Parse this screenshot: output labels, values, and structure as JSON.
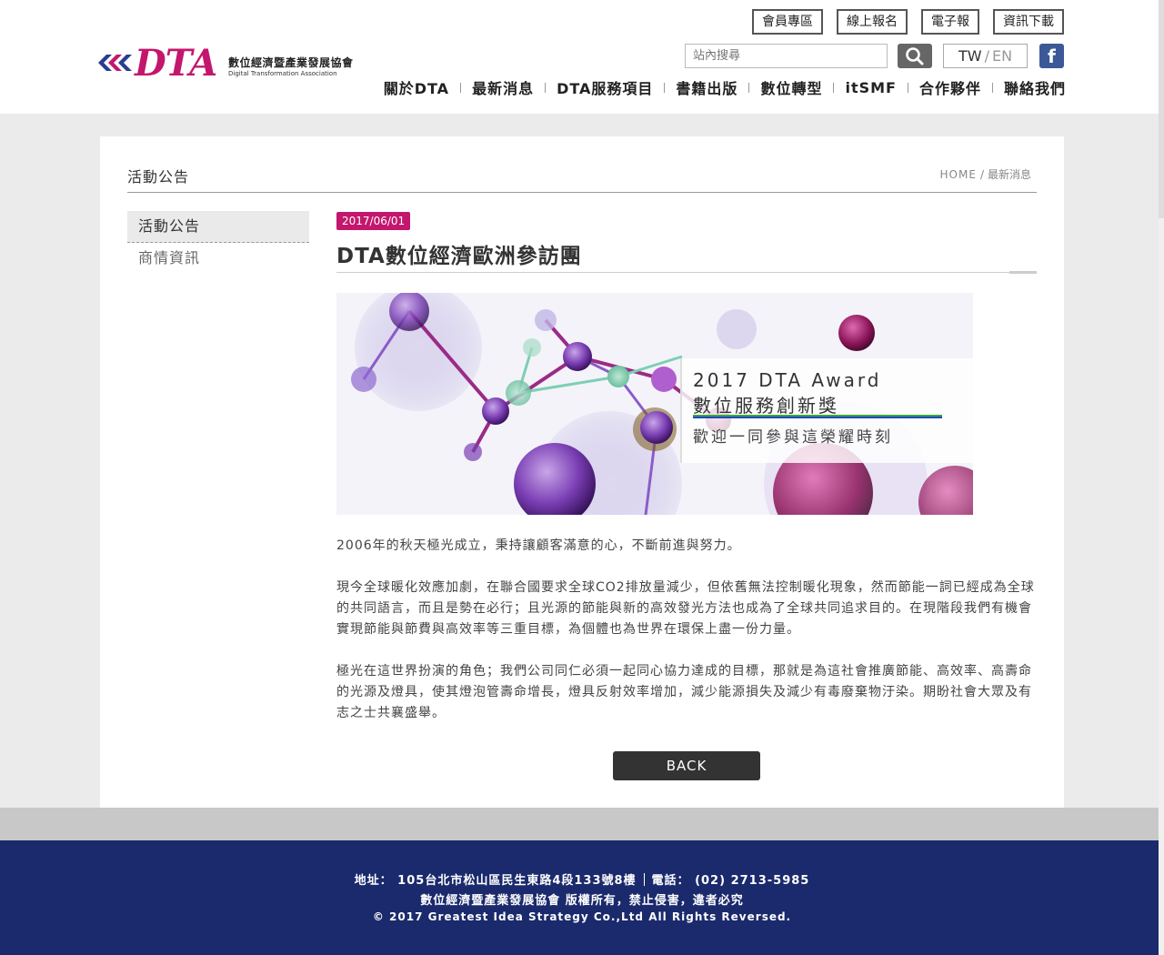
{
  "header": {
    "logo_text": "DTA",
    "logo_zh": "數位經濟暨產業發展協會",
    "logo_en": "Digital Transformation Association",
    "top_buttons": [
      "會員專區",
      "線上報名",
      "電子報",
      "資訊下載"
    ],
    "search_placeholder": "站內搜尋",
    "lang_tw": "TW",
    "lang_sep": "/",
    "lang_en": "EN",
    "facebook_label": "f",
    "nav": [
      "關於DTA",
      "最新消息",
      "DTA服務項目",
      "書籍出版",
      "數位轉型",
      "itSMF",
      "合作夥伴",
      "聯絡我們"
    ]
  },
  "page": {
    "title": "活動公告",
    "breadcrumb_home": "HOME",
    "breadcrumb_sep": "/",
    "breadcrumb_current": "最新消息"
  },
  "sidebar": {
    "items": [
      "活動公告",
      "商情資訊"
    ]
  },
  "article": {
    "date": "2017/06/01",
    "title": "DTA數位經濟歐洲參訪團",
    "banner_line1": "2017 DTA Award",
    "banner_line2": "數位服務創新獎",
    "banner_line3": "歡迎一同參與這榮耀時刻",
    "paragraphs": [
      "2006年的秋天極光成立，秉持讓顧客滿意的心，不斷前進與努力。",
      "現今全球暖化效應加劇，在聯合國要求全球CO2排放量減少，但依舊無法控制暖化現象，然而節能一詞已經成為全球的共同語言，而且是勢在必行；且光源的節能與新的高效發光方法也成為了全球共同追求目的。在現階段我們有機會實現節能與節費與高效率等三重目標，為個體也為世界在環保上盡一份力量。",
      "極光在這世界扮演的角色；我們公司同仁必須一起同心協力達成的目標，那就是為這社會推廣節能、高效率、高壽命的光源及燈具，使其燈泡管壽命增長，燈具反射效率增加，減少能源損失及減少有毒廢棄物汙染。期盼社會大眾及有志之士共襄盛舉。"
    ],
    "back_label": "BACK"
  },
  "footer": {
    "address": "地址： 105台北市松山區民生東路4段133號8樓",
    "phone": "電話： (02) 2713-5985",
    "rights_zh": "數位經濟暨產業發展協會 版權所有，禁止侵害，違者必究",
    "copyright": "© 2017 Greatest Idea Strategy Co.,Ltd All Rights Reversed."
  },
  "colors": {
    "brand": "#c3176d",
    "footer_bg": "#1a2a6c",
    "button_dark": "#333333"
  }
}
